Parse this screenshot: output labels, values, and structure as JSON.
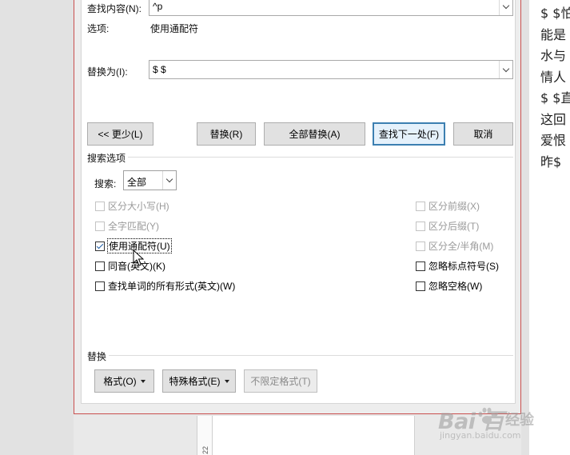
{
  "find_replace": {
    "find_label": "查找内容(N):",
    "find_value": "^p",
    "options_label": "选项:",
    "options_value": "使用通配符",
    "replace_label": "替换为(I):",
    "replace_value": "$ $",
    "buttons": {
      "less": "<< 更少(L)",
      "replace": "替换(R)",
      "replace_all": "全部替换(A)",
      "find_next": "查找下一处(F)",
      "cancel": "取消"
    },
    "search_options_title": "搜索选项",
    "search_label": "搜索:",
    "search_value": "全部",
    "left_options": [
      {
        "label": "区分大小写(H)",
        "checked": false,
        "disabled": true
      },
      {
        "label": "全字匹配(Y)",
        "checked": false,
        "disabled": true
      },
      {
        "label": "使用通配符(U)",
        "checked": true,
        "disabled": false
      },
      {
        "label": "同音(英文)(K)",
        "checked": false,
        "disabled": false
      },
      {
        "label": "查找单词的所有形式(英文)(W)",
        "checked": false,
        "disabled": false
      }
    ],
    "right_options": [
      {
        "label": "区分前缀(X)",
        "checked": false,
        "disabled": true
      },
      {
        "label": "区分后缀(T)",
        "checked": false,
        "disabled": true
      },
      {
        "label": "区分全/半角(M)",
        "checked": false,
        "disabled": true
      },
      {
        "label": "忽略标点符号(S)",
        "checked": false,
        "disabled": false
      },
      {
        "label": "忽略空格(W)",
        "checked": false,
        "disabled": false
      }
    ],
    "replace_section_title": "替换",
    "format_button": "格式(O)",
    "special_button": "特殊格式(E)",
    "no_format_button": "不限定格式(T)"
  },
  "document": {
    "lines": [
      "$ $怕",
      "能是",
      "水与",
      "情人",
      "$ $直",
      "这回",
      "爱恨",
      "昨$"
    ],
    "ruler_label": "22"
  },
  "watermark": {
    "main": "Bai  百",
    "sub": "经验",
    "url": "jingyan.baidu.com"
  },
  "colors": {
    "dialog_border": "#c9504f",
    "default_button_border": "#3c7fb1",
    "check_tick": "#1f5fa8"
  }
}
